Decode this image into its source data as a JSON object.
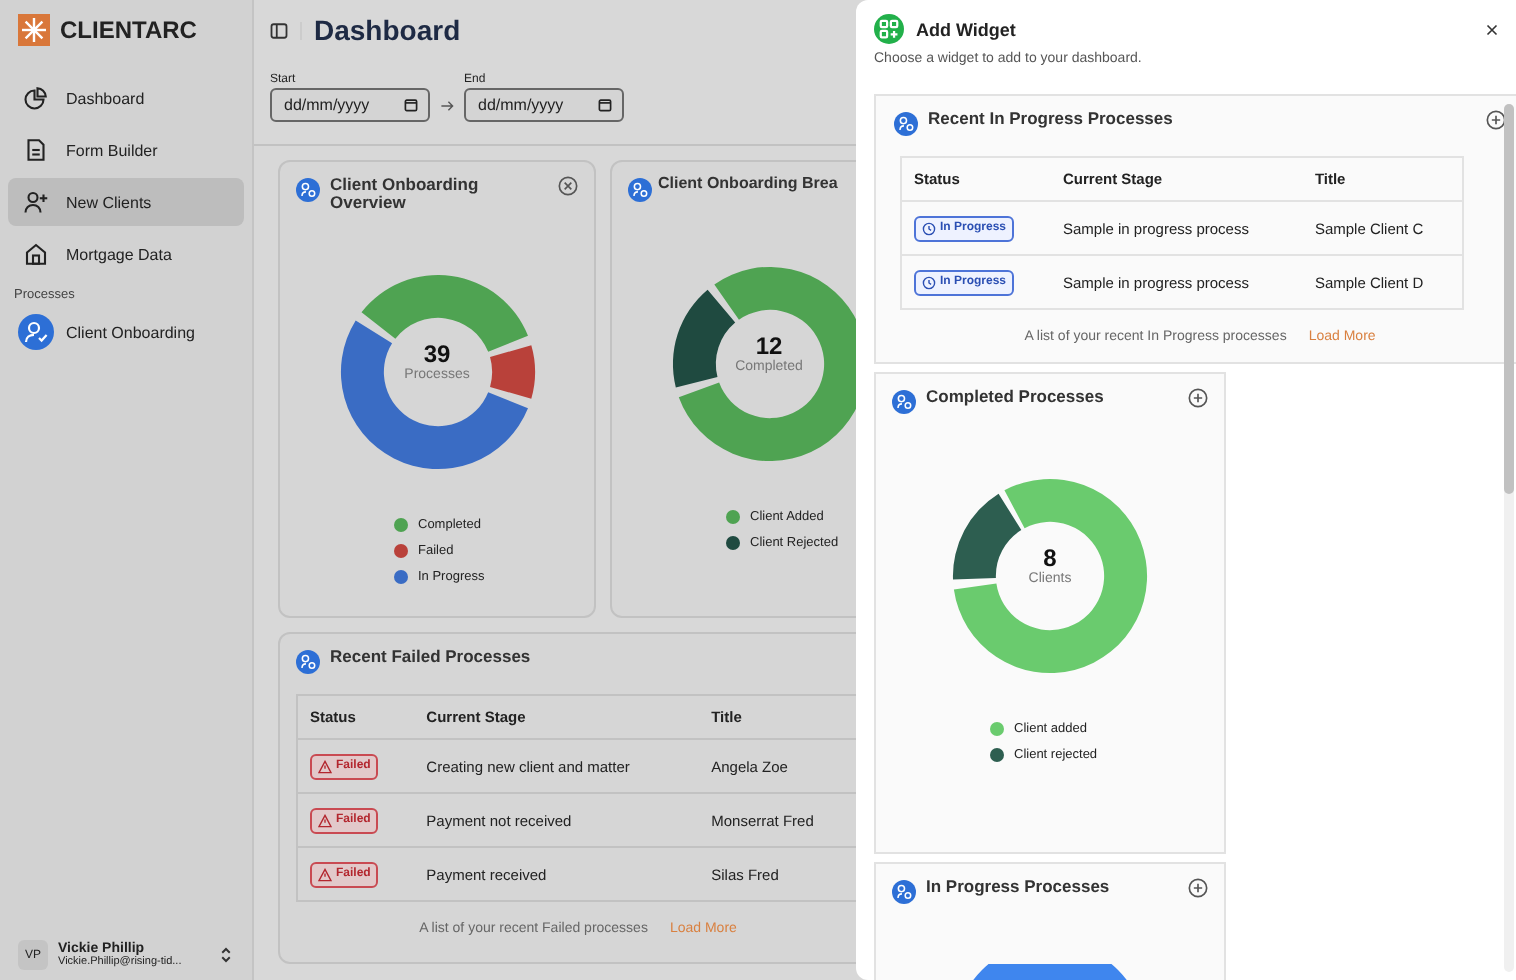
{
  "sidebar": {
    "brand": "CLIENTARC",
    "items": [
      {
        "label": "Dashboard",
        "selected": false
      },
      {
        "label": "Form Builder",
        "selected": false
      },
      {
        "label": "New Clients",
        "selected": true
      },
      {
        "label": "Mortgage Data",
        "selected": false
      }
    ],
    "section_label": "Processes",
    "processes": [
      {
        "label": "Client Onboarding",
        "selected": false
      }
    ],
    "user": {
      "initials": "VP",
      "name": "Vickie Phillip",
      "email": "Vickie.Phillip@rising-tid..."
    }
  },
  "header": {
    "title": "Dashboard"
  },
  "date_range": {
    "start": {
      "label": "Start",
      "placeholder": "dd/mm/yyyy"
    },
    "end": {
      "label": "End",
      "placeholder": "dd/mm/yyyy"
    }
  },
  "widgets": [
    {
      "kind": "donut",
      "title": "Client Onboarding Overview",
      "center_value": "39",
      "center_label": "Processes",
      "legend": [
        {
          "label": "Completed",
          "color": "#4fa352"
        },
        {
          "label": "Failed",
          "color": "#b9413a"
        },
        {
          "label": "In Progress",
          "color": "#3a6cc4"
        }
      ]
    },
    {
      "kind": "donut",
      "title": "Client Onboarding Brea",
      "center_value": "12",
      "center_label": "Completed",
      "legend": [
        {
          "label": "Client Added",
          "color": "#4fa352"
        },
        {
          "label": "Client Rejected",
          "color": "#1f4a40"
        }
      ]
    },
    {
      "kind": "table",
      "title": "Recent Failed Processes",
      "columns": [
        "Status",
        "Current Stage",
        "Title"
      ],
      "rows": [
        {
          "status": "Failed",
          "kind": "failed",
          "stage": "Creating new client and matter",
          "title": "Angela Zoe"
        },
        {
          "status": "Failed",
          "kind": "failed",
          "stage": "Payment not received",
          "title": "Monserrat Fred"
        },
        {
          "status": "Failed",
          "kind": "failed",
          "stage": "Payment received",
          "title": "Silas Fred"
        }
      ],
      "footer": "A list of your recent Failed processes",
      "link": "Load More"
    }
  ],
  "drawer": {
    "title": "Add Widget",
    "subtitle": "Choose a widget to add to your dashboard.",
    "widgets": [
      {
        "kind": "table",
        "title": "Recent In Progress Processes",
        "columns": [
          "Status",
          "Current Stage",
          "Title"
        ],
        "rows": [
          {
            "status": "In Progress",
            "kind": "in_progress",
            "stage": "Sample in progress process",
            "title": "Sample Client C"
          },
          {
            "status": "In Progress",
            "kind": "in_progress",
            "stage": "Sample in progress process",
            "title": "Sample Client D"
          }
        ],
        "footer": "A list of your recent In Progress processes",
        "link": "Load More"
      },
      {
        "kind": "donut",
        "title": "Completed Processes",
        "center_value": "8",
        "center_label": "Clients",
        "legend": [
          {
            "label": "Client added",
            "color": "#6acb6e"
          },
          {
            "label": "Client rejected",
            "color": "#2d5e50"
          }
        ]
      },
      {
        "kind": "donut",
        "title": "In Progress Processes"
      }
    ]
  }
}
